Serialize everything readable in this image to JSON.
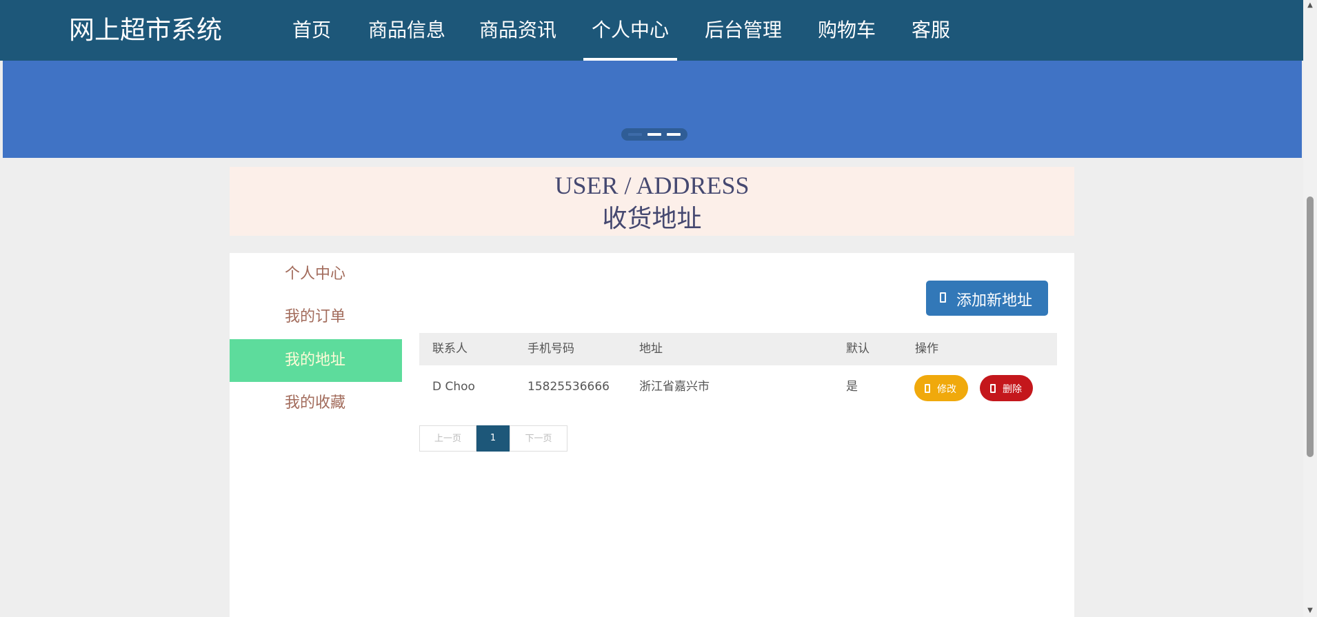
{
  "nav": {
    "brand": "网上超市系统",
    "items": [
      {
        "label": "首页"
      },
      {
        "label": "商品信息"
      },
      {
        "label": "商品资讯"
      },
      {
        "label": "个人中心",
        "active": true
      },
      {
        "label": "后台管理"
      },
      {
        "label": "购物车"
      },
      {
        "label": "客服"
      }
    ]
  },
  "page_title": {
    "en": "USER / ADDRESS",
    "cn": "收货地址"
  },
  "sidebar": {
    "items": [
      {
        "label": "个人中心"
      },
      {
        "label": "我的订单"
      },
      {
        "label": "我的地址",
        "active": true
      },
      {
        "label": "我的收藏"
      }
    ]
  },
  "actions": {
    "add_label": "添加新地址"
  },
  "table": {
    "columns": [
      "联系人",
      "手机号码",
      "地址",
      "默认",
      "操作"
    ],
    "rows": [
      {
        "name": "D Choo",
        "phone": "15825536666",
        "address": "浙江省嘉兴市",
        "default": "是",
        "edit_label": "修改",
        "delete_label": "删除"
      }
    ]
  },
  "pagination": {
    "prev_label": "上一页",
    "current": "1",
    "next_label": "下一页"
  },
  "colors": {
    "nav_bg": "#1d5779",
    "banner_bg": "#4073c5",
    "sidebar_active": "#5ddc9c",
    "add_button": "#3278b8",
    "edit_button": "#f0a90c",
    "delete_button": "#c4171c"
  }
}
